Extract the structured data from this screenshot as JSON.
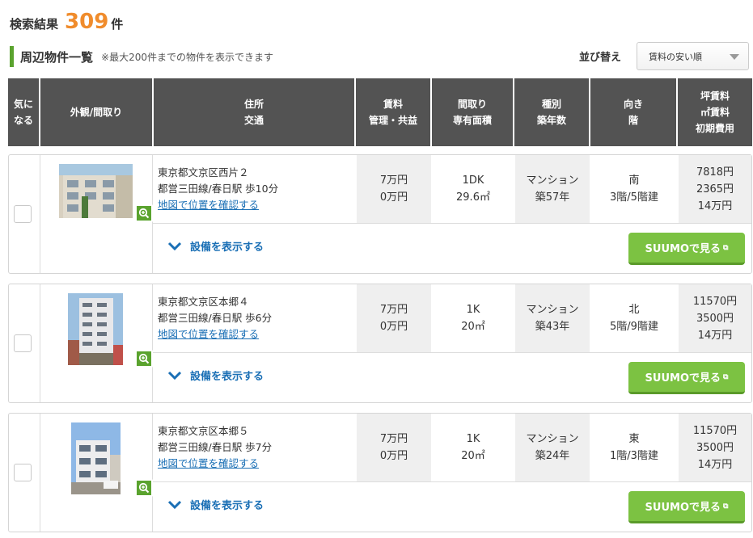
{
  "result": {
    "label": "検索結果",
    "count": "309",
    "unit": "件"
  },
  "list": {
    "title": "周辺物件一覧",
    "note": "※最大200件までの物件を表示できます"
  },
  "sort": {
    "label": "並び替え",
    "selected": "賃料の安い順"
  },
  "table_header": {
    "fav": [
      "気に",
      "なる"
    ],
    "photo": [
      "外観/間取り"
    ],
    "address": [
      "住所",
      "交通"
    ],
    "rent": [
      "賃料",
      "管理・共益"
    ],
    "layout": [
      "間取り",
      "専有面積"
    ],
    "type": [
      "種別",
      "築年数"
    ],
    "direction": [
      "向き",
      "階"
    ],
    "tsubo": [
      "坪賃料",
      "㎡賃料",
      "初期費用"
    ]
  },
  "properties": [
    {
      "address": "東京都文京区西片２",
      "access": "都営三田線/春日駅 歩10分",
      "map_link": "地図で位置を確認する",
      "rent": "7万円",
      "fee": "0万円",
      "madori": "1DK",
      "area": "29.6㎡",
      "kind": "マンション",
      "age": "築57年",
      "dir": "南",
      "floor": "3階/5階建",
      "tsubo": "7818円",
      "sqm": "2365円",
      "initial": "14万円",
      "equip": "設備を表示する",
      "suumo": "SUUMOで見る"
    },
    {
      "address": "東京都文京区本郷４",
      "access": "都営三田線/春日駅 歩6分",
      "map_link": "地図で位置を確認する",
      "rent": "7万円",
      "fee": "0万円",
      "madori": "1K",
      "area": "20㎡",
      "kind": "マンション",
      "age": "築43年",
      "dir": "北",
      "floor": "5階/9階建",
      "tsubo": "11570円",
      "sqm": "3500円",
      "initial": "14万円",
      "equip": "設備を表示する",
      "suumo": "SUUMOで見る"
    },
    {
      "address": "東京都文京区本郷５",
      "access": "都営三田線/春日駅 歩7分",
      "map_link": "地図で位置を確認する",
      "rent": "7万円",
      "fee": "0万円",
      "madori": "1K",
      "area": "20㎡",
      "kind": "マンション",
      "age": "築24年",
      "dir": "東",
      "floor": "1階/3階建",
      "tsubo": "11570円",
      "sqm": "3500円",
      "initial": "14万円",
      "equip": "設備を表示する",
      "suumo": "SUUMOで見る"
    }
  ],
  "colors": {
    "accent": "#f08c2c",
    "green": "#7cc242",
    "link": "#1a6fb5",
    "header_bg": "#535353"
  }
}
